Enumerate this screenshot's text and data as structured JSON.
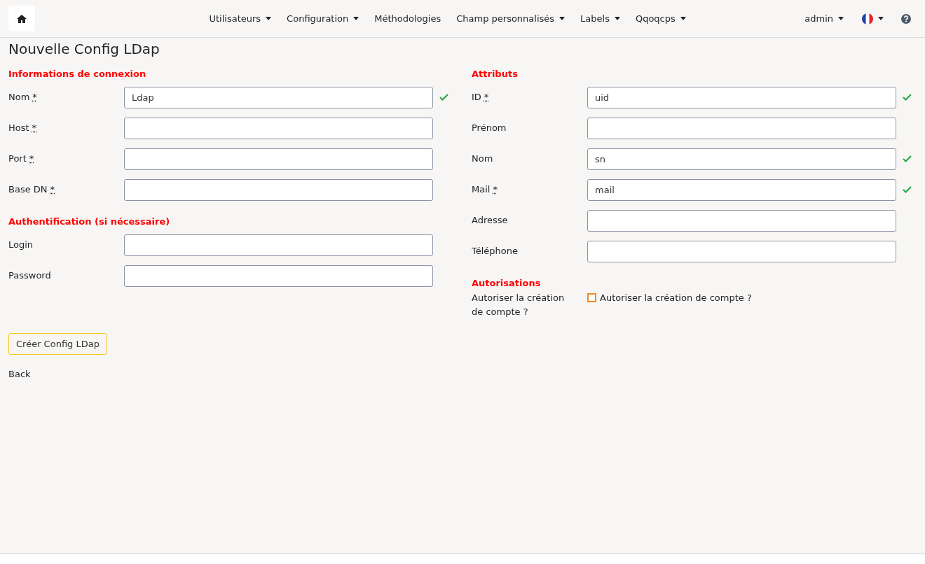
{
  "navbar": {
    "menus": [
      {
        "label": "Utilisateurs",
        "dropdown": true
      },
      {
        "label": "Configuration",
        "dropdown": true
      },
      {
        "label": "Méthodologies",
        "dropdown": false
      },
      {
        "label": "Champ personnalisés",
        "dropdown": true
      },
      {
        "label": "Labels",
        "dropdown": true
      },
      {
        "label": "Qqoqcps",
        "dropdown": true
      }
    ],
    "user": {
      "label": "admin",
      "dropdown": true
    },
    "language": {
      "dropdown": true
    }
  },
  "page_title": "Nouvelle Config LDap",
  "columns": [
    {
      "sections": [
        {
          "heading": "Informations de connexion",
          "fields": [
            {
              "kind": "text",
              "label": "Nom",
              "required_mark": "*",
              "value": "Ldap",
              "valid": true
            },
            {
              "kind": "text",
              "label": "Host",
              "required_mark": "*",
              "valid": false
            },
            {
              "kind": "text",
              "label": "Port",
              "required_mark": "*",
              "valid": false
            },
            {
              "kind": "text",
              "label": "Base DN",
              "required_mark": "*",
              "valid": false
            }
          ]
        },
        {
          "heading": "Authentification (si nécessaire)",
          "fields": [
            {
              "kind": "text",
              "label": "Login",
              "valid": false
            },
            {
              "kind": "password",
              "label": "Password",
              "valid": false
            }
          ]
        }
      ]
    },
    {
      "sections": [
        {
          "heading": "Attributs",
          "fields": [
            {
              "kind": "text",
              "label": "ID",
              "required_mark": "*",
              "value": "uid",
              "valid": true
            },
            {
              "kind": "text",
              "label": "Prénom",
              "valid": false
            },
            {
              "kind": "text",
              "label": "Nom",
              "value": "sn",
              "valid": true
            },
            {
              "kind": "text",
              "label": "Mail",
              "required_mark": "*",
              "value": "mail",
              "valid": true
            },
            {
              "kind": "text",
              "label": "Adresse",
              "valid": false
            },
            {
              "kind": "text",
              "label": "Téléphone",
              "valid": false
            }
          ]
        },
        {
          "heading": "Autorisations",
          "fields": [
            {
              "kind": "checkbox",
              "label": "Autoriser la création de compte ?",
              "option": "Autoriser la création de compte ?",
              "checked": false
            }
          ]
        }
      ]
    }
  ],
  "submit_button": "Créer Config LDap",
  "back_link": "Back"
}
